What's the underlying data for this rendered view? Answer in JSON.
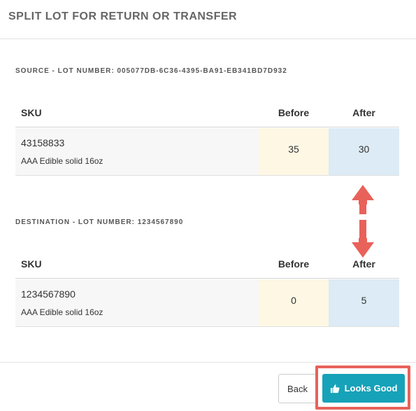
{
  "dialog": {
    "title": "SPLIT LOT FOR RETURN OR TRANSFER"
  },
  "source": {
    "label": "SOURCE - LOT NUMBER: 005077DB-6C36-4395-BA91-EB341BD7D932",
    "columns": {
      "sku": "SKU",
      "before": "Before",
      "after": "After"
    },
    "row": {
      "sku": "43158833",
      "name": "AAA Edible solid 16oz",
      "before": "35",
      "after": "30"
    }
  },
  "destination": {
    "label": "DESTINATION - LOT NUMBER: 1234567890",
    "columns": {
      "sku": "SKU",
      "before": "Before",
      "after": "After"
    },
    "row": {
      "sku": "1234567890",
      "name": "AAA Edible solid 16oz",
      "before": "0",
      "after": "5"
    }
  },
  "footer": {
    "back_label": "Back",
    "confirm_label": "Looks Good",
    "confirm_icon": "thumbs-up-icon"
  },
  "annotations": {
    "arrow_color": "#e8625a",
    "highlight_color": "#e8625a"
  },
  "colors": {
    "accent": "#16a2b8",
    "before_bg": "#fdf7e4",
    "after_bg": "#dcebf5"
  }
}
